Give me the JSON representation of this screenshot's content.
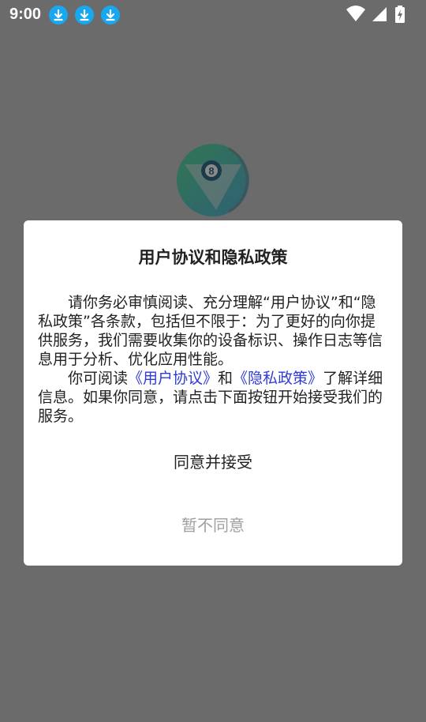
{
  "status_bar": {
    "time": "9:00",
    "icons": [
      "download-icon",
      "download-icon",
      "download-icon",
      "wifi-icon",
      "signal-icon",
      "battery-charging-icon"
    ]
  },
  "colors": {
    "overlay": "#6b6b6b",
    "dialog_bg": "#ffffff",
    "link": "#2f3bd6",
    "muted_button": "#a0a0a0",
    "download_badge": "#18a8f0"
  },
  "dialog": {
    "title": "用户协议和隐私政策",
    "paragraph1": "请你务必审慎阅读、充分理解“用户协议”和“隐私政策”各条款，包括但不限于：为了更好的向你提供服务，我们需要收集你的设备标识、操作日志等信息用于分析、优化应用性能。",
    "paragraph2_prefix": "你可阅读",
    "user_agreement_link": "《用户协议》",
    "paragraph2_and": "和",
    "privacy_policy_link": "《隐私政策》",
    "paragraph2_suffix": "了解详细信息。如果你同意，请点击下面按钮开始接受我们的服务。",
    "agree_label": "同意并接受",
    "disagree_label": "暂不同意"
  }
}
